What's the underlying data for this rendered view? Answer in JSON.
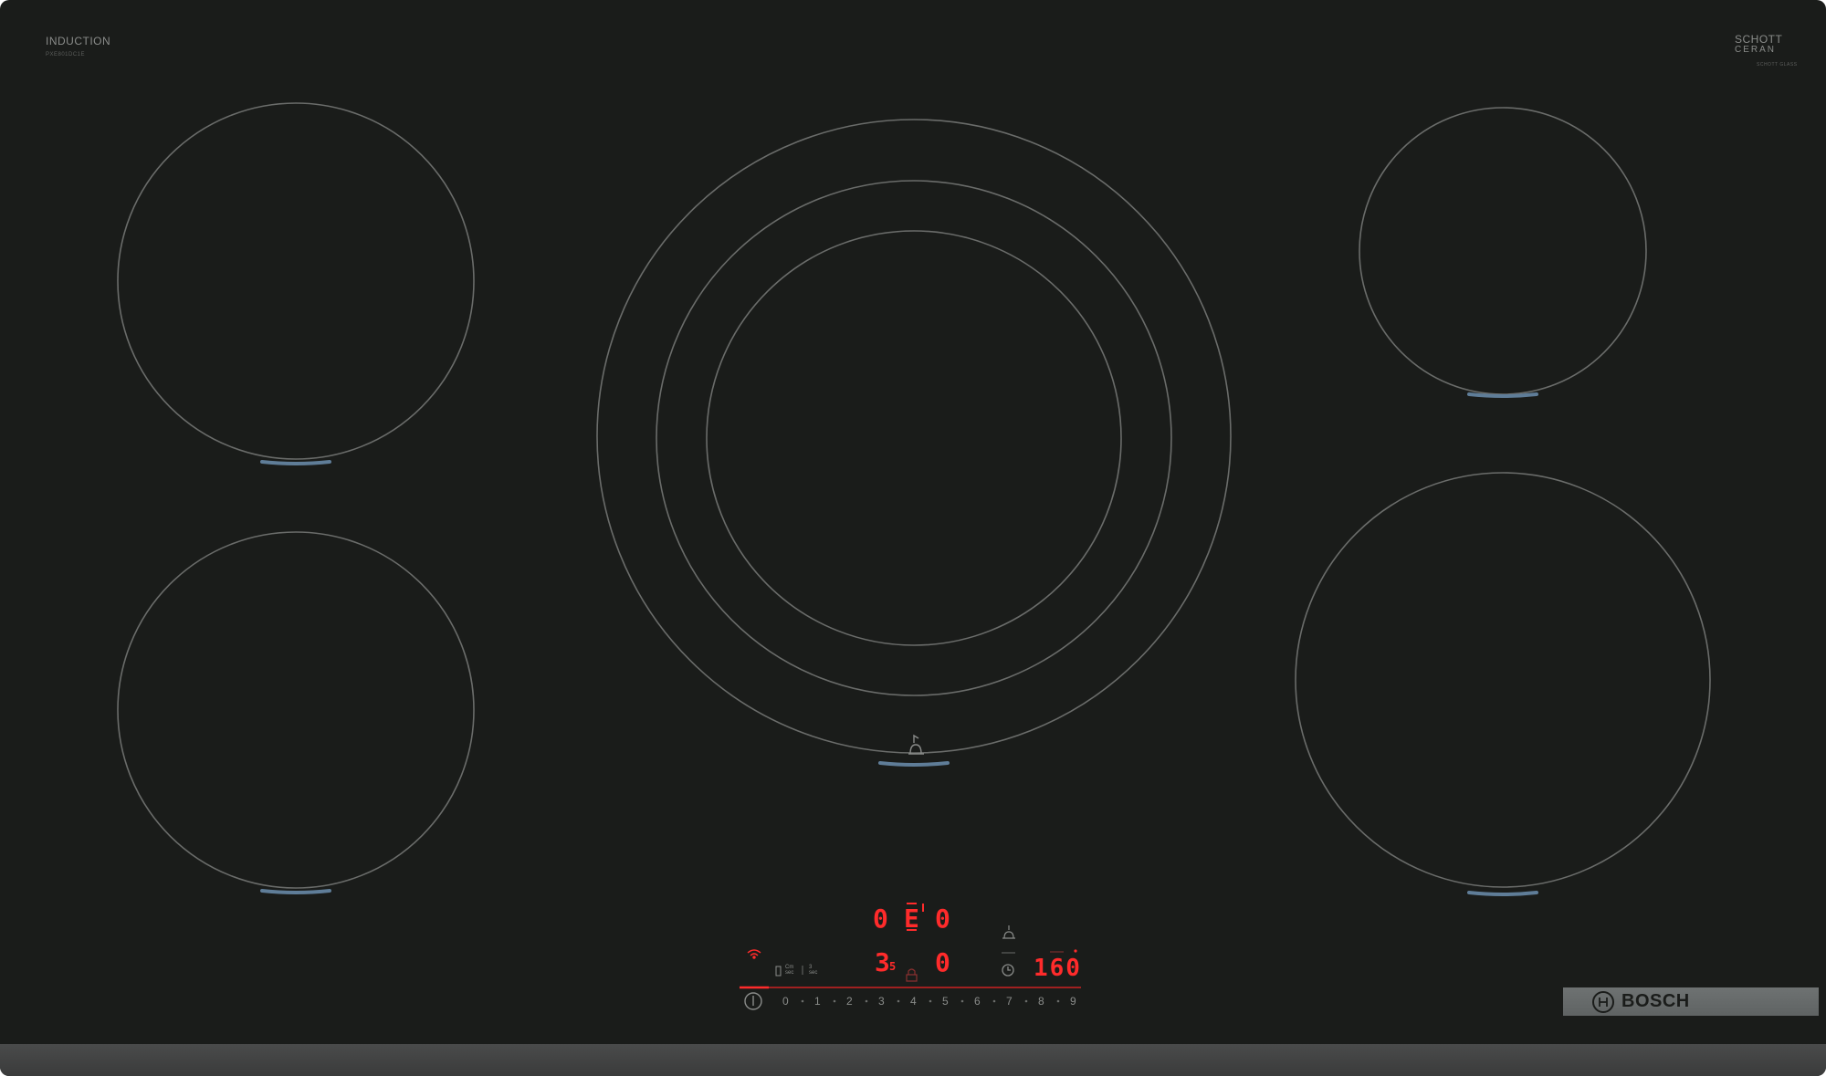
{
  "hob": {
    "type_label": "INDUCTION",
    "model_label": "PXE801DC1E",
    "glass_brand_line1": "SCHOTT",
    "glass_brand_line2": "CERAN",
    "glass_brand_sub": "SCHOTT GLASS",
    "manufacturer": "BOSCH"
  },
  "control_panel": {
    "display_top_left": "0",
    "display_top_center": "E",
    "display_top_right": "0",
    "display_bottom_left": "3",
    "display_bottom_left_sub": "5",
    "display_bottom_right": "0",
    "timer_display": "160",
    "mode_button_1": "Cm\nsec",
    "mode_button_2": "3\nsec",
    "power_scale": [
      "0",
      "1",
      "2",
      "3",
      "4",
      "5",
      "6",
      "7",
      "8",
      "9"
    ]
  },
  "colors": {
    "glass": "#1a1c1a",
    "zone_outline": "#6a6c6a",
    "display_red": "#ff2b2b",
    "brand_plate": "#6b6f6f"
  },
  "icons": {
    "wifi": "wifi-icon",
    "power": "power-icon",
    "timer": "timer-icon",
    "pan_sensor": "pan-sensor-icon",
    "lock": "lock-icon"
  }
}
